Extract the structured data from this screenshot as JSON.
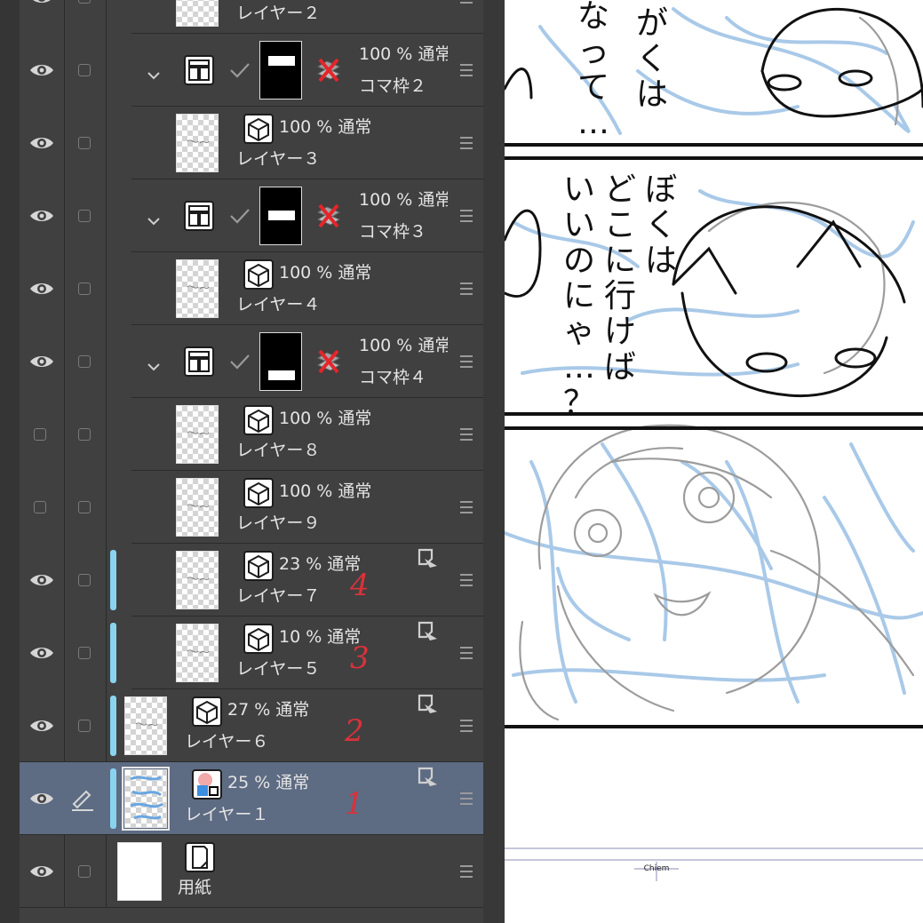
{
  "layers_panel": {
    "rows": [
      {
        "name": "レイヤー２",
        "kind": "raster"
      },
      {
        "name": "コマ枠２",
        "opacity": "100 %",
        "blend": "通常",
        "kind": "frame-folder"
      },
      {
        "name": "レイヤー３",
        "opacity": "100 %",
        "blend": "通常",
        "kind": "raster"
      },
      {
        "name": "コマ枠３",
        "opacity": "100 %",
        "blend": "通常",
        "kind": "frame-folder"
      },
      {
        "name": "レイヤー４",
        "opacity": "100 %",
        "blend": "通常",
        "kind": "raster"
      },
      {
        "name": "コマ枠４",
        "opacity": "100 %",
        "blend": "通常",
        "kind": "frame-folder"
      },
      {
        "name": "レイヤー８",
        "opacity": "100 %",
        "blend": "通常",
        "kind": "raster",
        "hidden": true
      },
      {
        "name": "レイヤー９",
        "opacity": "100 %",
        "blend": "通常",
        "kind": "raster",
        "hidden": true
      },
      {
        "name": "レイヤー７",
        "opacity": "23 %",
        "blend": "通常",
        "kind": "raster",
        "reference": true,
        "note": "4"
      },
      {
        "name": "レイヤー５",
        "opacity": "10 %",
        "blend": "通常",
        "kind": "raster",
        "reference": true,
        "note": "3"
      },
      {
        "name": "レイヤー６",
        "opacity": "27 %",
        "blend": "通常",
        "kind": "raster",
        "reference": true,
        "note": "2"
      },
      {
        "name": "レイヤー１",
        "opacity": "25 %",
        "blend": "通常",
        "kind": "color-raster",
        "reference": true,
        "note": "1",
        "selected": true,
        "editing": true
      },
      {
        "name": "用紙",
        "kind": "paper"
      }
    ],
    "icons": {
      "visibility": "eye-icon",
      "edit_target": "pen-icon",
      "expand": "chevron-down-icon",
      "frame_folder": "frame-folder-icon",
      "raster": "raster-layer-icon",
      "reference": "reference-layer-icon",
      "menu": "layer-menu-icon"
    },
    "colors": {
      "panel_bg": "#404040",
      "selected_row": "#5d6b83",
      "color_bar": "#8ad3ef",
      "handwritten_note": "#d9323a"
    }
  },
  "canvas": {
    "panel_text": [
      {
        "lines": [
          "がくは",
          "なって…"
        ]
      },
      {
        "lines": [
          "ぼくは",
          "どこに行けば",
          "いいのにゃ…？"
        ]
      }
    ],
    "signature": "Chiem",
    "colors": {
      "sketch_blue": "#a9c9e8",
      "sketch_gray": "#9c9c9c",
      "ink": "#111111"
    }
  }
}
